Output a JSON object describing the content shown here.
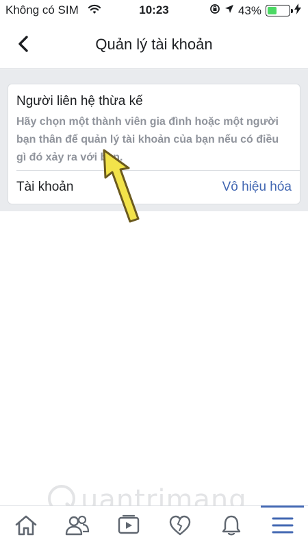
{
  "status_bar": {
    "carrier": "Không có SIM",
    "time": "10:23",
    "battery_percent": "43%",
    "battery_level": 0.43,
    "battery_color": "#4cd964"
  },
  "header": {
    "title": "Quản lý tài khoản",
    "back_icon": "chevron-left-icon"
  },
  "card": {
    "title": "Người liên hệ thừa kế",
    "description": "Hãy chọn một thành viên gia đình hoặc một người bạn thân để quản lý tài khoản của bạn nếu có điều gì đó xảy ra với bạn.",
    "row_label": "Tài khoản",
    "row_action": "Vô hiệu hóa",
    "link_color": "#4267b2"
  },
  "watermark": {
    "text": "uantrimang"
  },
  "tab_bar": {
    "tabs": [
      {
        "icon": "home-icon"
      },
      {
        "icon": "friends-icon"
      },
      {
        "icon": "video-icon"
      },
      {
        "icon": "heart-icon"
      },
      {
        "icon": "bell-icon"
      },
      {
        "icon": "menu-icon",
        "active": true
      }
    ],
    "accent": "#4267b2"
  }
}
